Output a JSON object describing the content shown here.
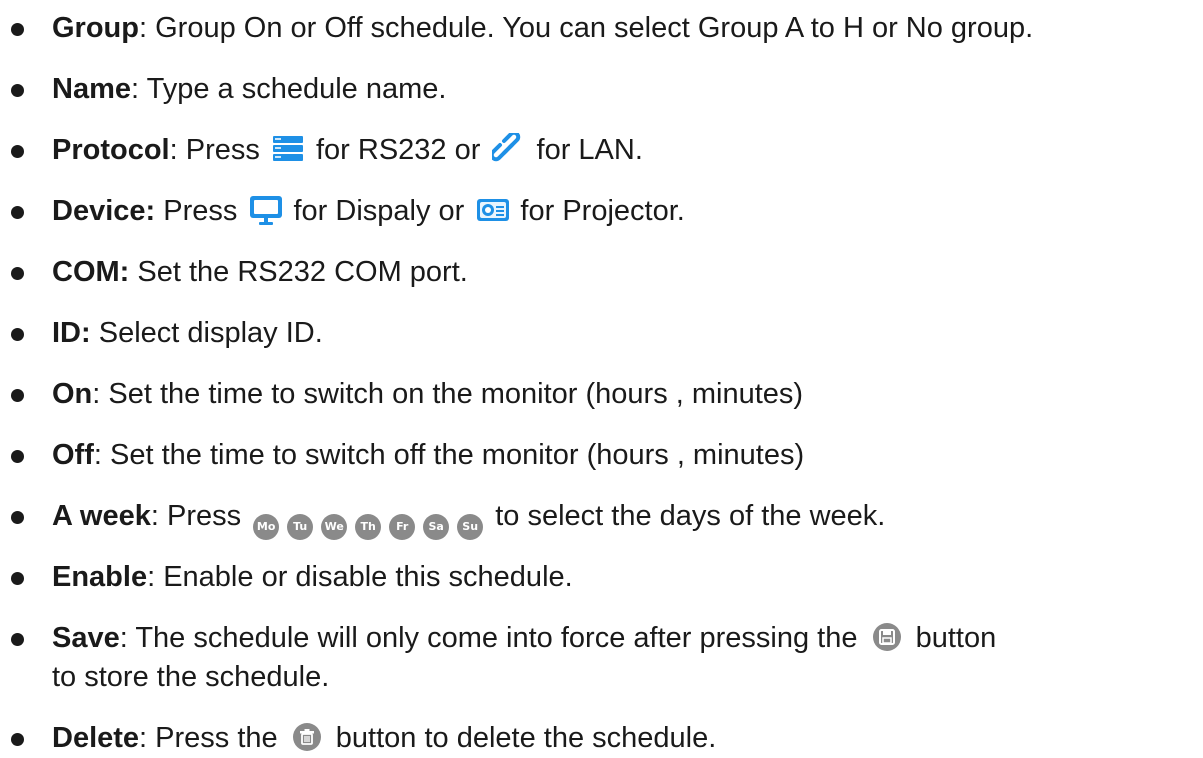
{
  "items": [
    {
      "term": "Group",
      "text": ": Group On or Off schedule. You can select Group A to H or No group."
    },
    {
      "term": "Name",
      "text": ": Type a schedule name."
    },
    {
      "term": "Protocol",
      "t1": ": Press ",
      "t2": " for RS232 or ",
      "t3": " for LAN."
    },
    {
      "term": "Device:",
      "t1": " Press ",
      "t2": " for Dispaly or ",
      "t3": " for Projector."
    },
    {
      "term": "COM:",
      "text": " Set the RS232 COM port."
    },
    {
      "term": "ID:",
      "text": " Select display ID."
    },
    {
      "term": "On",
      "text": ": Set the time to switch on the monitor (hours , minutes)"
    },
    {
      "term": "Off",
      "text": ": Set the time to switch off the monitor (hours , minutes)"
    },
    {
      "term": "A week",
      "t1": ": Press ",
      "t2": " to select the days of the week."
    },
    {
      "term": "Enable",
      "text": ": Enable or disable this schedule."
    },
    {
      "term": "Save",
      "t1": ": The schedule will only come into force after pressing the ",
      "t2": " button",
      "line2": "to store the schedule."
    },
    {
      "term": "Delete",
      "t1": ": Press the ",
      "t2": " button to delete the schedule."
    }
  ],
  "days": [
    "Mo",
    "Tu",
    "We",
    "Th",
    "Fr",
    "Sa",
    "Su"
  ],
  "icons": {
    "rs232": "server-stack-icon",
    "lan": "chain-link-icon",
    "display": "monitor-icon",
    "projector": "projector-icon",
    "save": "floppy-disk-icon",
    "delete": "trash-can-icon"
  },
  "colors": {
    "text": "#1a1a1a",
    "icon_blue": "#1e90e6",
    "day_gray": "#8a8a8a"
  }
}
